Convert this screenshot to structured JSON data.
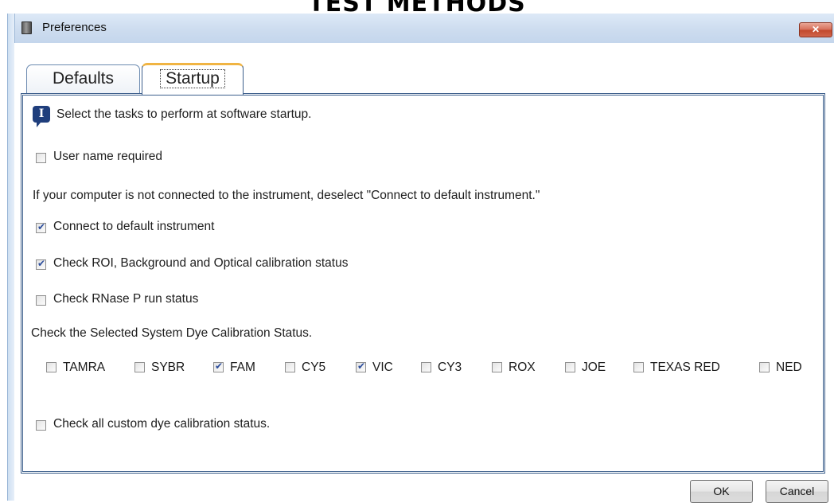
{
  "background": {
    "title": "TEST METHODS"
  },
  "window": {
    "title": "Preferences",
    "close_label": "✕"
  },
  "tabs": [
    {
      "label": "Defaults",
      "selected": false
    },
    {
      "label": "Startup",
      "selected": true
    }
  ],
  "startup": {
    "info_text": "Select the tasks to perform at software startup.",
    "user_name_required": {
      "label": "User name required",
      "checked": false
    },
    "note": "If your computer is not connected to the instrument, deselect \"Connect to default instrument.\"",
    "connect_default": {
      "label": "Connect to default instrument",
      "checked": true
    },
    "check_roi": {
      "label": "Check ROI, Background and Optical calibration status",
      "checked": true
    },
    "check_rnase": {
      "label": "Check RNase P run status",
      "checked": false
    },
    "dye_heading": "Check the Selected System Dye Calibration Status.",
    "dyes": [
      {
        "label": "TAMRA",
        "checked": false
      },
      {
        "label": "SYBR",
        "checked": false
      },
      {
        "label": "FAM",
        "checked": true
      },
      {
        "label": "CY5",
        "checked": false
      },
      {
        "label": "VIC",
        "checked": true
      },
      {
        "label": "CY3",
        "checked": false
      },
      {
        "label": "ROX",
        "checked": false
      },
      {
        "label": "JOE",
        "checked": false
      },
      {
        "label": "TEXAS RED",
        "checked": false
      },
      {
        "label": "NED",
        "checked": false
      }
    ],
    "custom_dye": {
      "label": "Check all custom dye calibration status.",
      "checked": false
    }
  },
  "buttons": {
    "ok": "OK",
    "cancel": "Cancel"
  },
  "colors": {
    "panel_border": "#3d5f8c",
    "tab_focus": "#f0b443",
    "check_mark": "#2d4e9c",
    "close_button": "#c24a2e"
  },
  "icons": {
    "app": "app-icon",
    "info": "info-icon",
    "close": "close-icon"
  }
}
